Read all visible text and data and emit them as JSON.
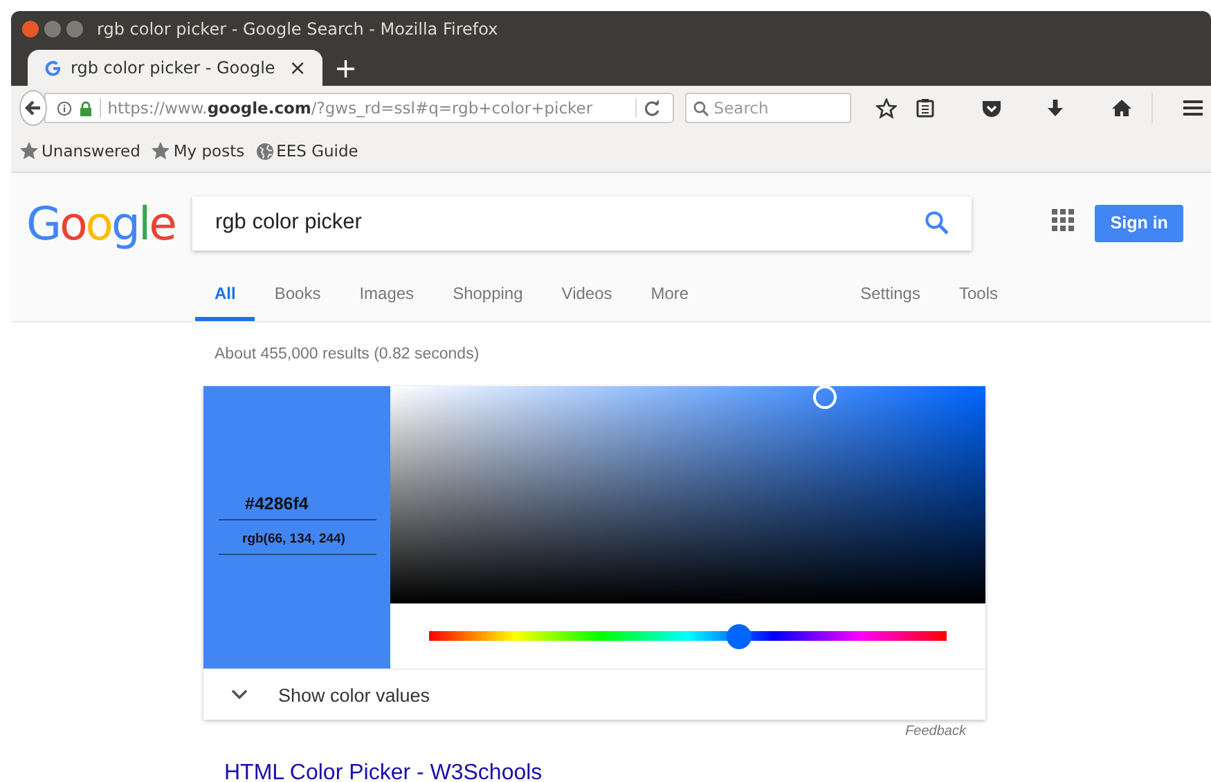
{
  "window": {
    "title": "rgb color picker - Google Search - Mozilla Firefox"
  },
  "browser_tabs": [
    {
      "label": "rgb color picker - Google",
      "close": "×",
      "selected": true
    }
  ],
  "new_tab": "+",
  "address_bar": {
    "url_prefix": "https://www.",
    "url_domain": "google.com",
    "url_rest": "/?gws_rd=ssl#q=rgb+color+picker"
  },
  "search_bar": {
    "placeholder": "Search"
  },
  "bookmarks": [
    {
      "label": "Unanswered",
      "kind": "star"
    },
    {
      "label": "My posts",
      "kind": "star"
    },
    {
      "label": "EES Guide",
      "kind": "globe"
    }
  ],
  "google": {
    "logo": "Google",
    "query": "rgb color picker",
    "sign_in": "Sign in",
    "tabs": [
      {
        "label": "All",
        "selected": true
      },
      {
        "label": "Books",
        "selected": false
      },
      {
        "label": "Images",
        "selected": false
      },
      {
        "label": "Shopping",
        "selected": false
      },
      {
        "label": "Videos",
        "selected": false
      },
      {
        "label": "More",
        "selected": false
      }
    ],
    "tools": [
      "Settings",
      "Tools"
    ],
    "result_stats": "About 455,000 results (0.82 seconds)"
  },
  "color_picker": {
    "color": "#4286f4",
    "hex": "#4286f4",
    "rgb": "rgb(66, 134, 244)",
    "saturation": {
      "level": 0.73
    },
    "hue": {
      "level": 0.6
    },
    "show_values": "Show color values",
    "expanded": false,
    "feedback": "Feedback"
  },
  "first_result": {
    "title": "HTML Color Picker - W3Schools"
  }
}
